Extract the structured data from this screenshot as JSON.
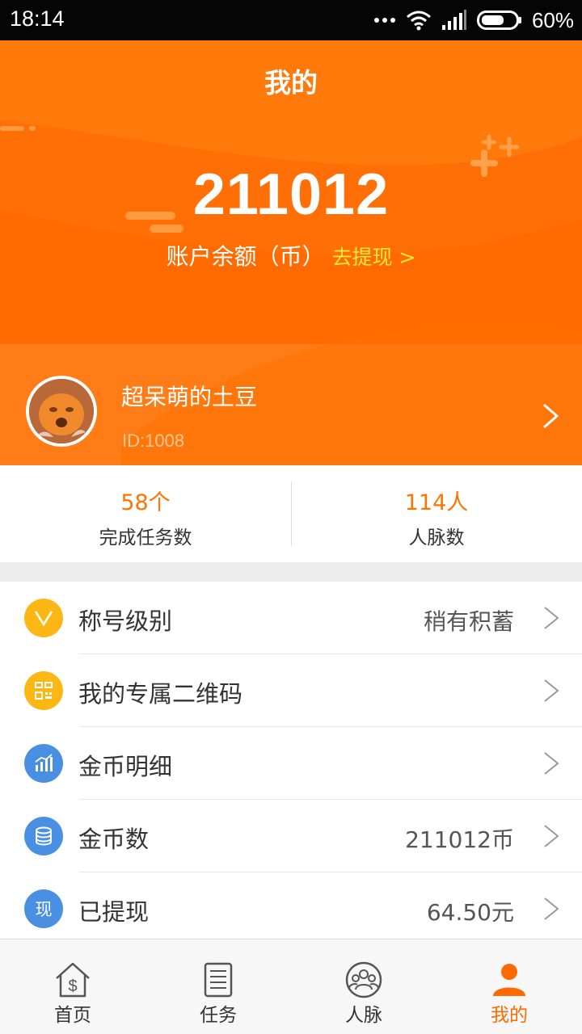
{
  "status_bar": {
    "time": "18:14",
    "battery_percent": "60%"
  },
  "header": {
    "title": "我的",
    "balance": "211012",
    "balance_label": "账户余额（币）",
    "withdraw_link": "去提现 >"
  },
  "profile": {
    "name": "超呆萌的土豆",
    "id": "ID:1008"
  },
  "stats": [
    {
      "value": "58个",
      "label": "完成任务数"
    },
    {
      "value": "114人",
      "label": "人脉数"
    }
  ],
  "menu": [
    {
      "label": "称号级别",
      "value": "稍有积蓄",
      "icon": "level-v-icon"
    },
    {
      "label": "我的专属二维码",
      "value": "",
      "icon": "qr-code-icon"
    },
    {
      "label": "金币明细",
      "value": "",
      "icon": "bar-chart-icon"
    },
    {
      "label": "金币数",
      "value": "211012币",
      "icon": "coin-stack-icon"
    },
    {
      "label": "已提现",
      "value": "64.50元",
      "icon": "withdrawn-icon",
      "icon_text": "现"
    }
  ],
  "bottom_nav": [
    {
      "label": "首页",
      "icon": "home-dollar-icon"
    },
    {
      "label": "任务",
      "icon": "task-list-icon"
    },
    {
      "label": "人脉",
      "icon": "contacts-icon"
    },
    {
      "label": "我的",
      "icon": "profile-icon",
      "active": true
    }
  ],
  "colors": {
    "brand_orange": "#ff7a0a",
    "accent_yellow": "#ffea3a",
    "active_tab": "#ff6a00"
  }
}
